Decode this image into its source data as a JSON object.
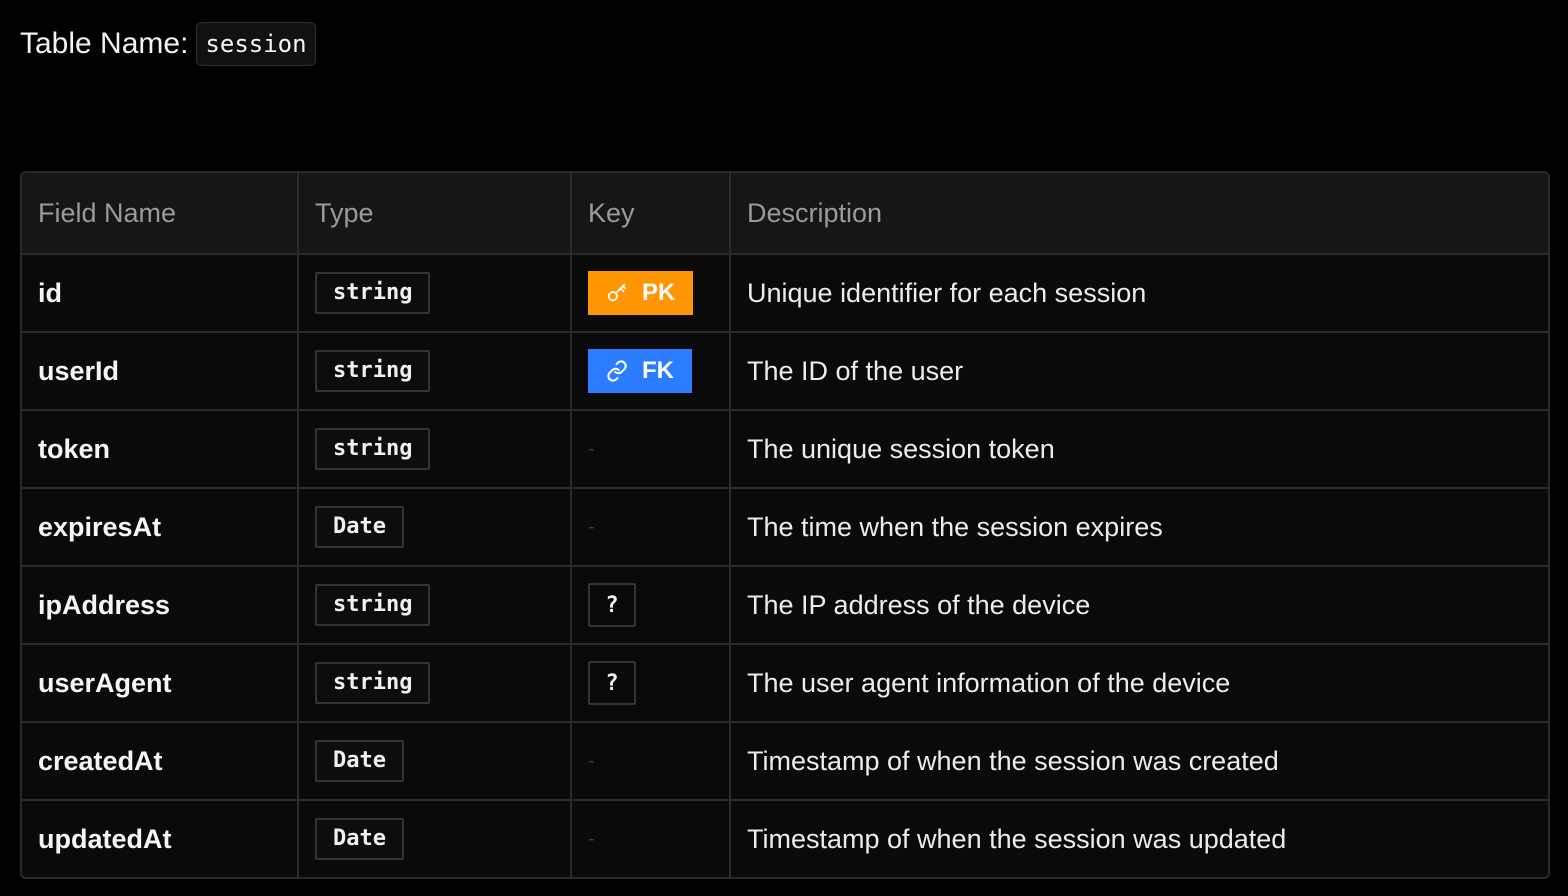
{
  "title": {
    "label": "Table Name:",
    "table_name": "session"
  },
  "columns": {
    "field_name": "Field Name",
    "type": "Type",
    "key": "Key",
    "description": "Description"
  },
  "rows": [
    {
      "name": "id",
      "type": "string",
      "key": "PK",
      "key_kind": "pk",
      "key_icon": "key-icon",
      "description": "Unique identifier for each session"
    },
    {
      "name": "userId",
      "type": "string",
      "key": "FK",
      "key_kind": "fk",
      "key_icon": "link-icon",
      "description": "The ID of the user"
    },
    {
      "name": "token",
      "type": "string",
      "key": "-",
      "key_kind": "none",
      "description": "The unique session token"
    },
    {
      "name": "expiresAt",
      "type": "Date",
      "key": "-",
      "key_kind": "none",
      "description": "The time when the session expires"
    },
    {
      "name": "ipAddress",
      "type": "string",
      "key": "?",
      "key_kind": "optional",
      "description": "The IP address of the device"
    },
    {
      "name": "userAgent",
      "type": "string",
      "key": "?",
      "key_kind": "optional",
      "description": "The user agent information of the device"
    },
    {
      "name": "createdAt",
      "type": "Date",
      "key": "-",
      "key_kind": "none",
      "description": "Timestamp of when the session was created"
    },
    {
      "name": "updatedAt",
      "type": "Date",
      "key": "-",
      "key_kind": "none",
      "description": "Timestamp of when the session was updated"
    }
  ],
  "colors": {
    "pk_badge": "#ff9500",
    "fk_badge": "#2b7cff",
    "background": "#000000",
    "table_background": "#0a0a0a",
    "border": "#2a2a2a"
  }
}
